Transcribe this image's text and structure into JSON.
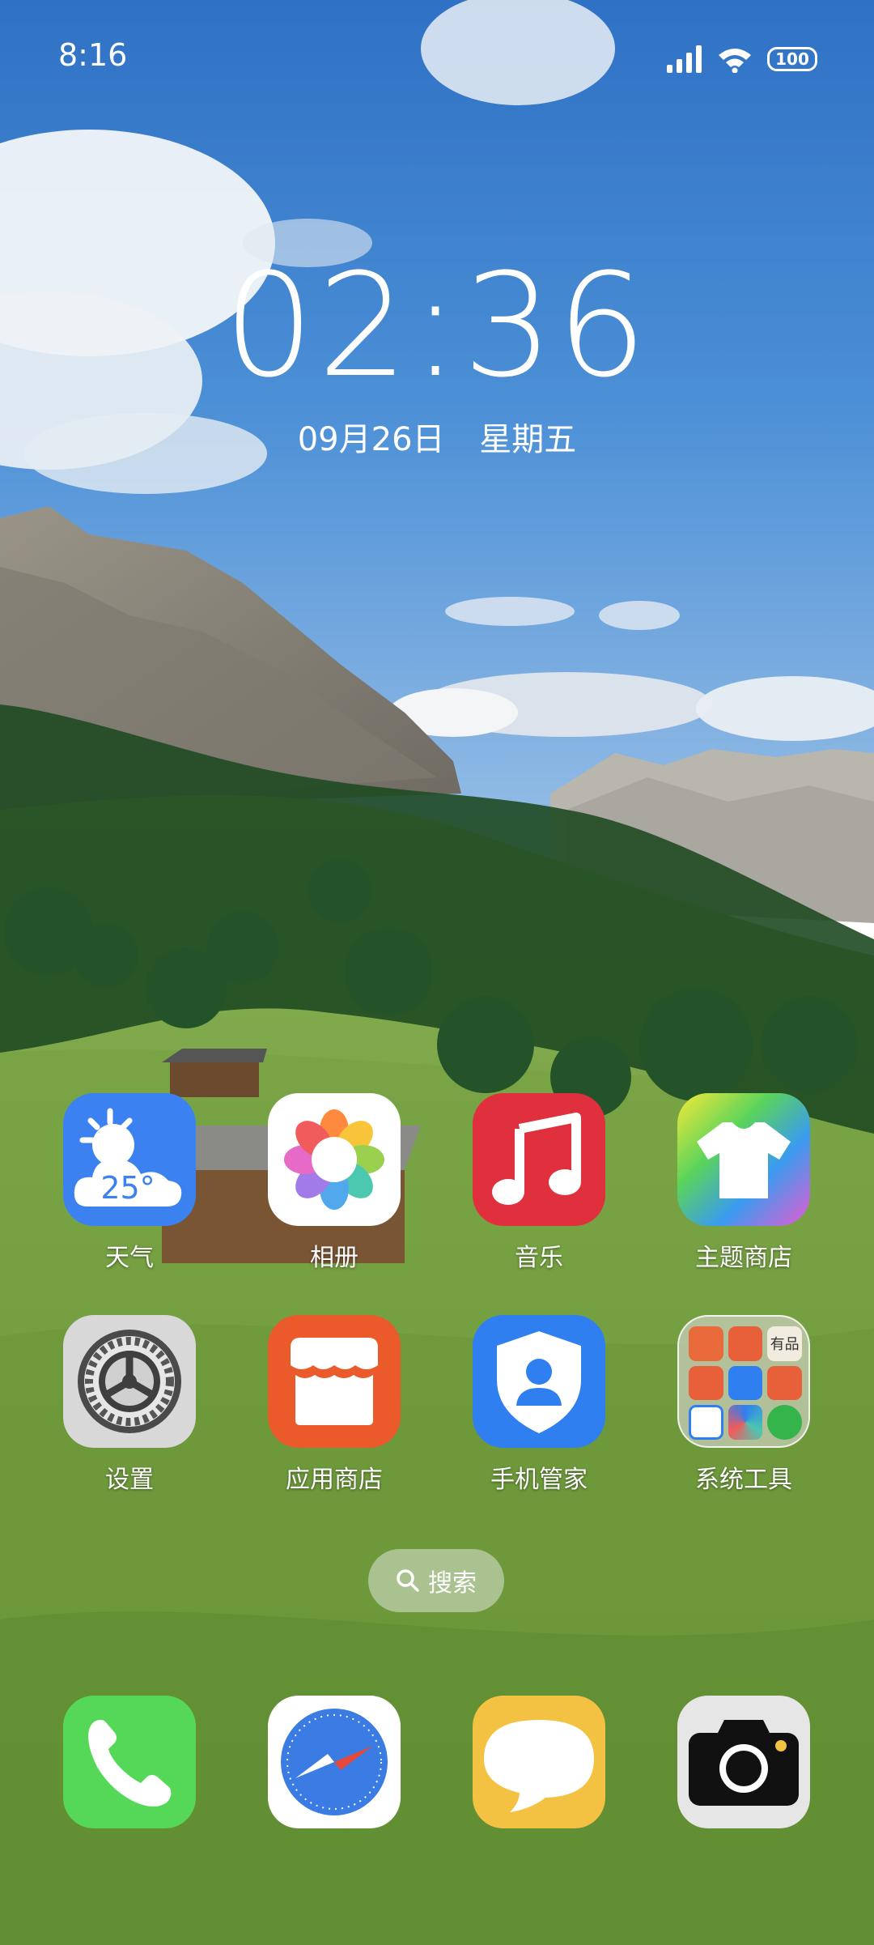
{
  "status_bar": {
    "time": "8:16",
    "battery": "100",
    "icons": [
      "signal-icon",
      "wifi-icon",
      "battery-icon"
    ]
  },
  "clock_widget": {
    "time": "02:36",
    "date": "09月26日 星期五"
  },
  "apps": [
    {
      "label": "天气",
      "icon": "weather-icon",
      "temp": "25°"
    },
    {
      "label": "相册",
      "icon": "gallery-icon"
    },
    {
      "label": "音乐",
      "icon": "music-icon"
    },
    {
      "label": "主题商店",
      "icon": "theme-store-icon"
    },
    {
      "label": "设置",
      "icon": "settings-icon"
    },
    {
      "label": "应用商店",
      "icon": "app-store-icon"
    },
    {
      "label": "手机管家",
      "icon": "phone-manager-icon"
    },
    {
      "label": "系统工具",
      "icon": "system-tools-folder-icon",
      "mini_text": "有品"
    }
  ],
  "search": {
    "label": "搜索"
  },
  "dock": [
    {
      "icon": "phone-icon"
    },
    {
      "icon": "browser-compass-icon"
    },
    {
      "icon": "messages-icon"
    },
    {
      "icon": "camera-icon"
    }
  ]
}
